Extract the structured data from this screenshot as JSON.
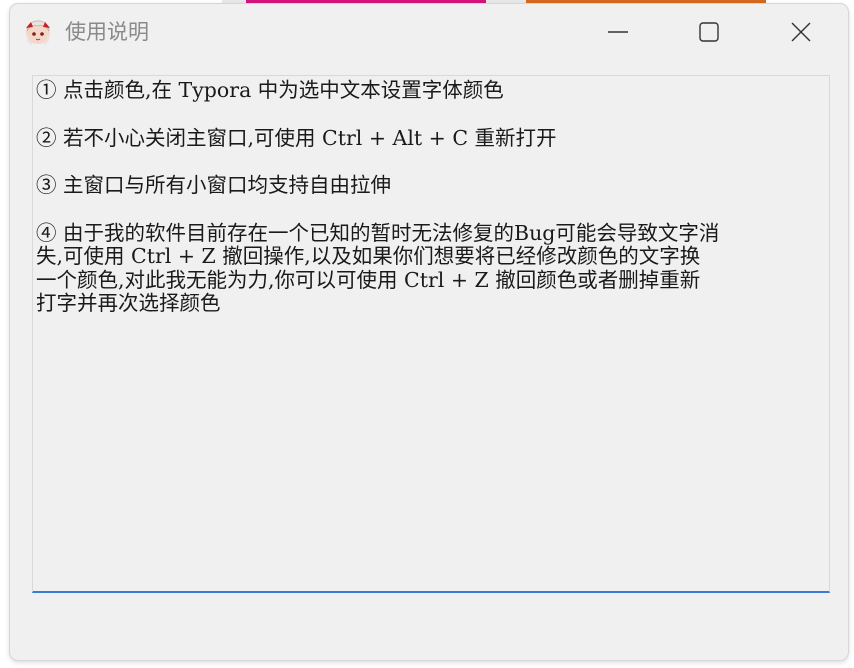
{
  "window": {
    "title": "使用说明",
    "app_icon": "anime-avatar-icon",
    "controls": {
      "minimize": "minimize-icon",
      "maximize": "maximize-icon",
      "close": "close-icon"
    }
  },
  "colors": {
    "strip_left": "#e8e8e8",
    "strip_magenta": "#d4147c",
    "strip_orange": "#d2691e",
    "focus_underline": "#3a7bd5"
  },
  "content": {
    "items": [
      {
        "lines": [
          "① 点击颜色,在 Typora 中为选中文本设置字体颜色"
        ]
      },
      {
        "lines": [
          "② 若不小心关闭主窗口,可使用 Ctrl + Alt + C 重新打开"
        ]
      },
      {
        "lines": [
          "③ 主窗口与所有小窗口均支持自由拉伸"
        ]
      },
      {
        "lines": [
          "④ 由于我的软件目前存在一个已知的暂时无法修复的Bug可能会导致文字消",
          "失,可使用 Ctrl + Z 撤回操作,以及如果你们想要将已经修改颜色的文字换",
          "一个颜色,对此我无能为力,你可以可使用 Ctrl + Z 撤回颜色或者删掉重新",
          "打字并再次选择颜色"
        ]
      }
    ]
  }
}
